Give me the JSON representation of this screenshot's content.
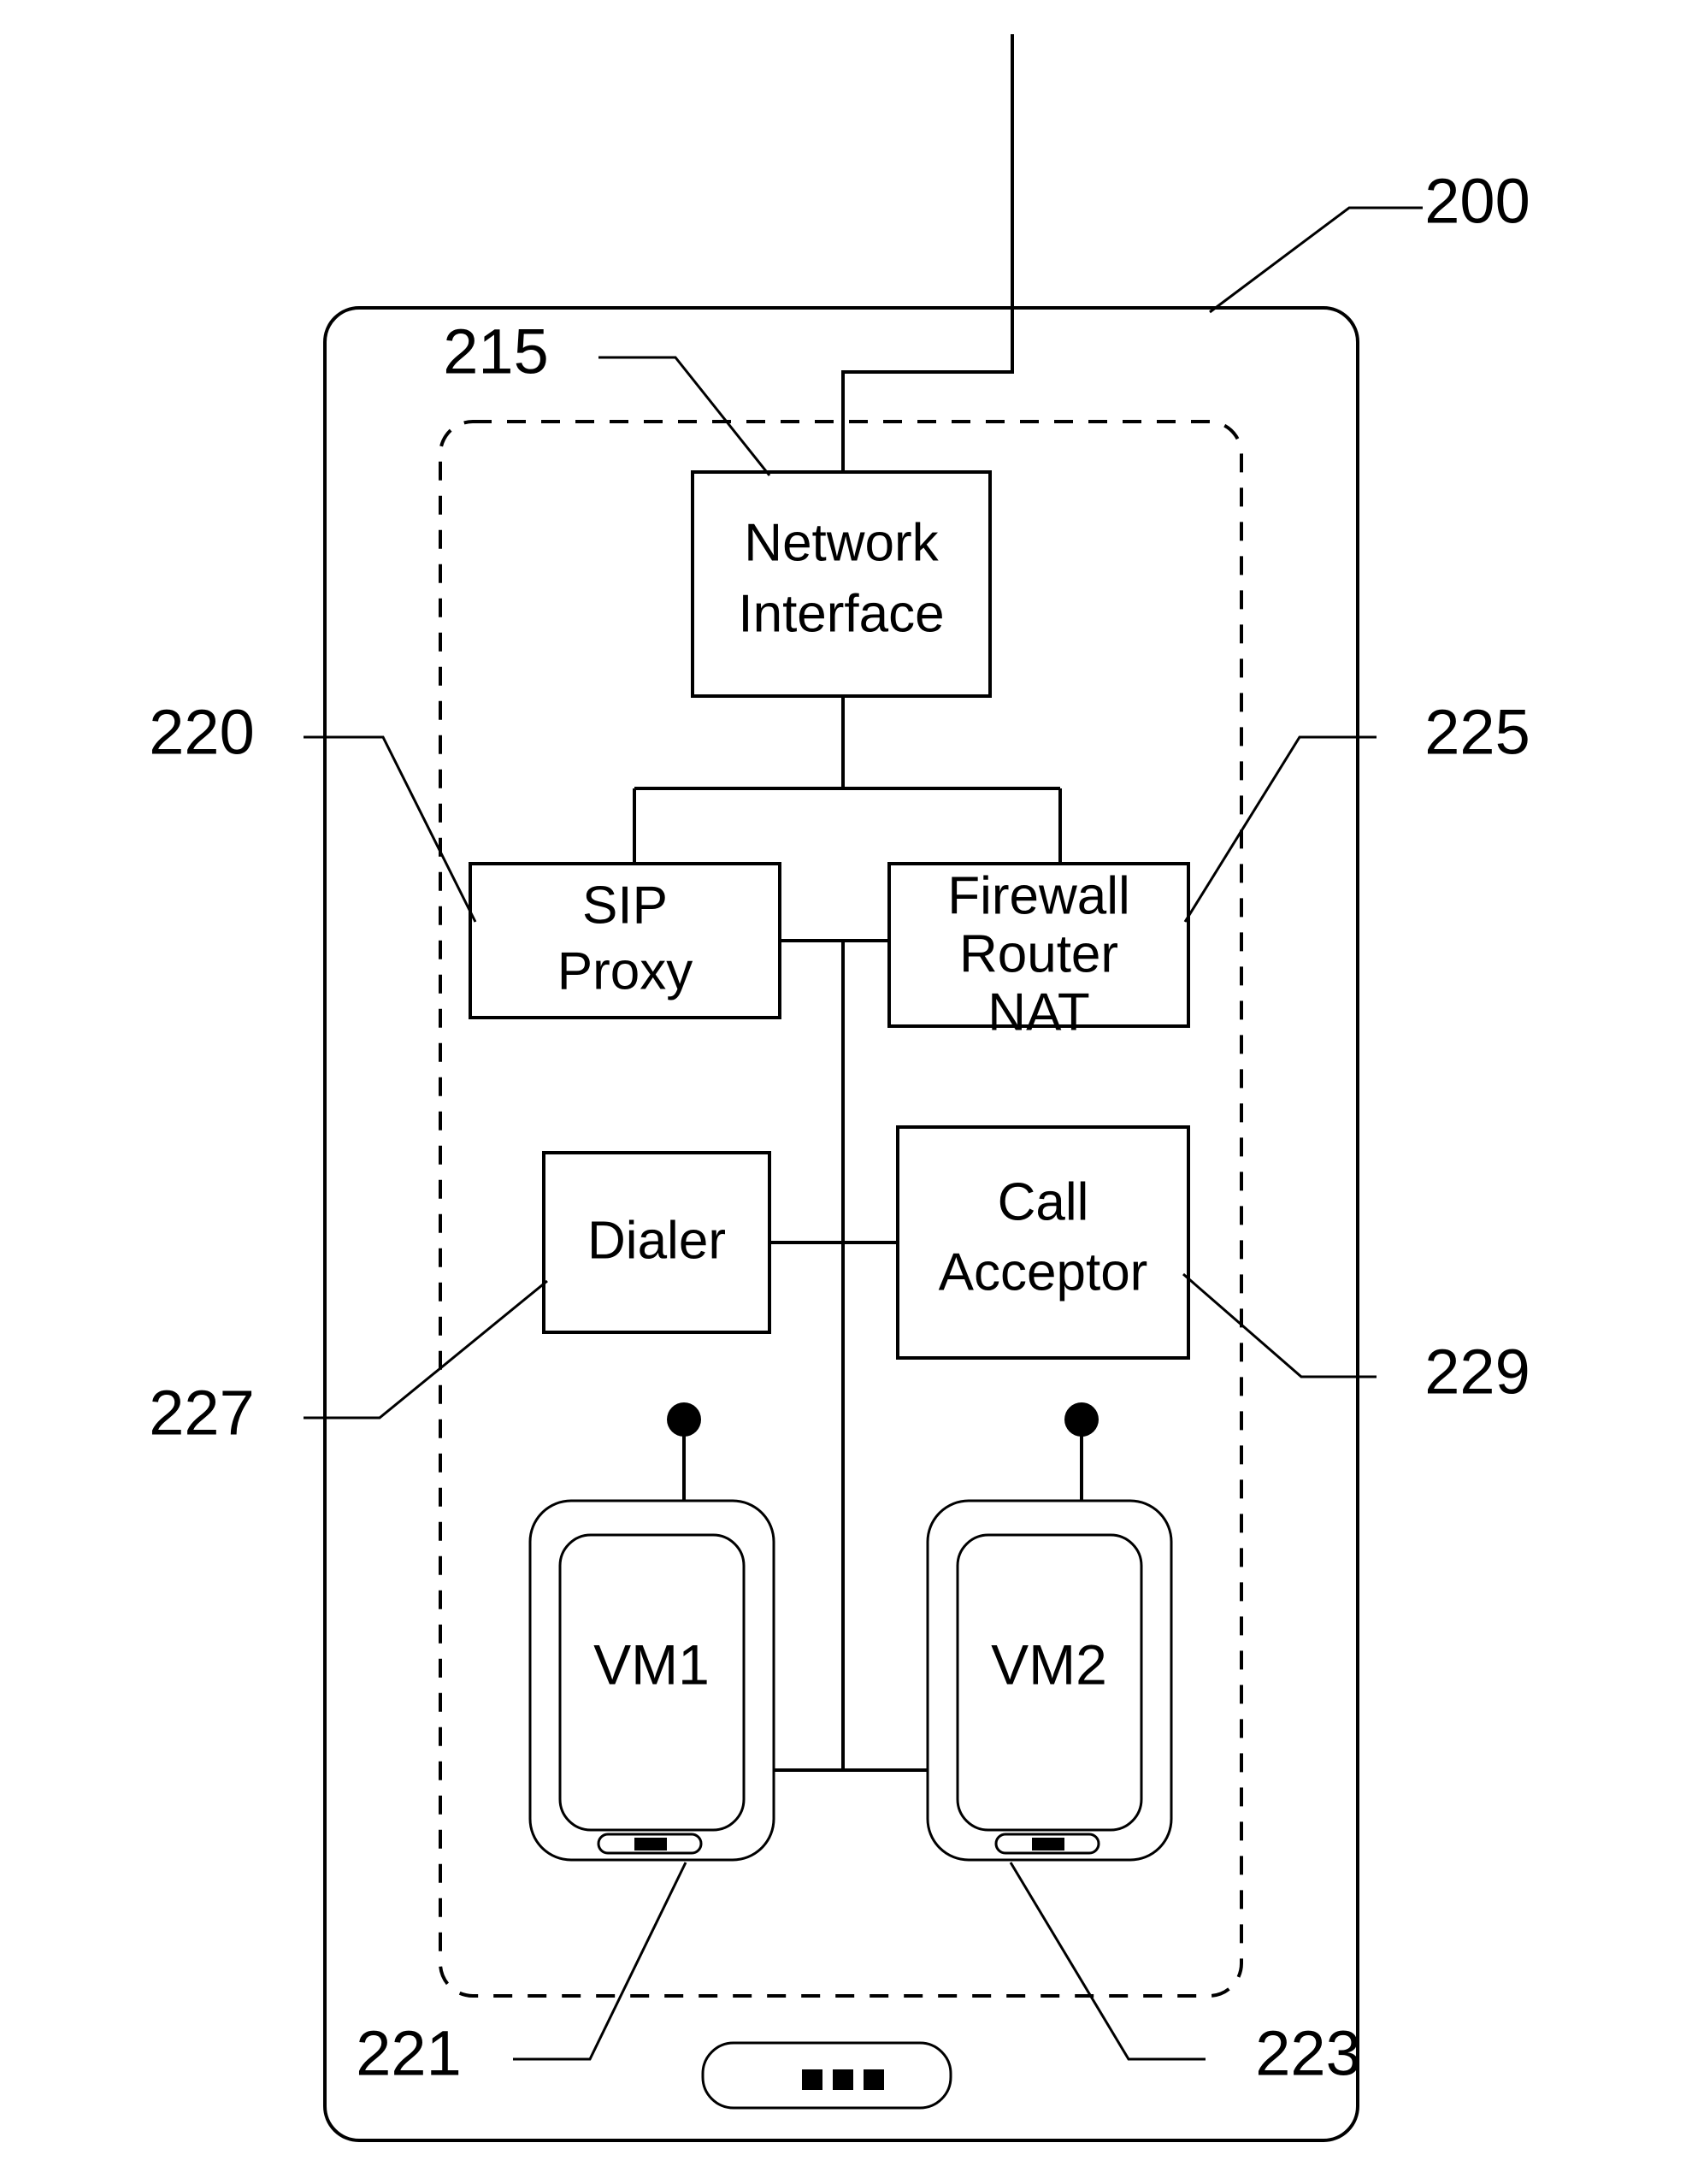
{
  "figure": {
    "type": "patent-block-diagram",
    "background_color": "#ffffff",
    "line_color": "#000000",
    "reference_numerals": {
      "device": "200",
      "network_interface": "215",
      "sip_proxy": "220",
      "firewall_router_nat": "225",
      "dialer": "227",
      "call_acceptor": "229",
      "vm1": "221",
      "vm2": "223"
    },
    "blocks": {
      "network_interface": {
        "line1": "Network",
        "line2": "Interface"
      },
      "sip_proxy": {
        "line1": "SIP",
        "line2": "Proxy"
      },
      "firewall": {
        "line1": "Firewall",
        "line2": "Router",
        "line3": "NAT"
      },
      "dialer": {
        "line1": "Dialer"
      },
      "call_acceptor": {
        "line1": "Call",
        "line2": "Acceptor"
      },
      "vm1": {
        "label": "VM1"
      },
      "vm2": {
        "label": "VM2"
      }
    },
    "icons": {
      "home_button": "home-button-icon",
      "vm1_antenna_dot": "antenna-dot-icon",
      "vm2_antenna_dot": "antenna-dot-icon",
      "vm1_speaker": "speaker-slot-icon",
      "vm2_speaker": "speaker-slot-icon"
    }
  }
}
